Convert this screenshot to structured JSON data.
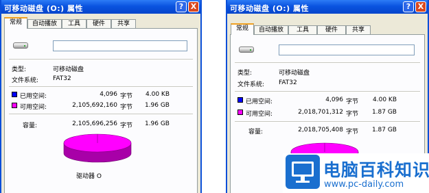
{
  "window1": {
    "title": "可移动磁盘 (O:) 属性",
    "help_btn": "?",
    "close_btn": "X",
    "tabs": [
      "常规",
      "自动播放",
      "工具",
      "硬件",
      "共享"
    ],
    "type_label": "类型:",
    "type_value": "可移动磁盘",
    "fs_label": "文件系统:",
    "fs_value": "FAT32",
    "used_label": "已用空间:",
    "used_bytes": "4,096",
    "used_unit": "字节",
    "used_size": "4.00 KB",
    "free_label": "可用空间:",
    "free_bytes": "2,105,692,160",
    "free_unit": "字节",
    "free_size": "1.96 GB",
    "capacity_label": "容量:",
    "capacity_bytes": "2,105,696,256",
    "capacity_unit": "字节",
    "capacity_size": "1.96 GB",
    "drive_label": "驱动器 O",
    "used_fraction": 2e-06
  },
  "window2": {
    "title": "可移动磁盘 (O:) 属性",
    "help_btn": "?",
    "close_btn": "X",
    "tabs": [
      "常规",
      "自动播放",
      "工具",
      "硬件",
      "共享"
    ],
    "type_label": "类型:",
    "type_value": "可移动磁盘",
    "fs_label": "文件系统:",
    "fs_value": "FAT32",
    "used_label": "已用空间:",
    "used_bytes": "4,096",
    "used_unit": "字节",
    "used_size": "4.00 KB",
    "free_label": "可用空间:",
    "free_bytes": "2,018,701,312",
    "free_unit": "字节",
    "free_size": "1.87 GB",
    "capacity_label": "容量:",
    "capacity_bytes": "2,018,705,408",
    "capacity_unit": "字节",
    "capacity_size": "1.87 GB",
    "used_fraction": 2e-06
  },
  "colors": {
    "used": "#0000ff",
    "free": "#ff00ff",
    "titlebar": "#0a54e0",
    "watermark": "#1a6fcf"
  },
  "icons": [
    "removable-drive-icon",
    "help-icon",
    "close-icon",
    "site-logo-icon"
  ],
  "watermark": {
    "name": "电脑百科知识",
    "url": "www.pc-daily.com"
  }
}
